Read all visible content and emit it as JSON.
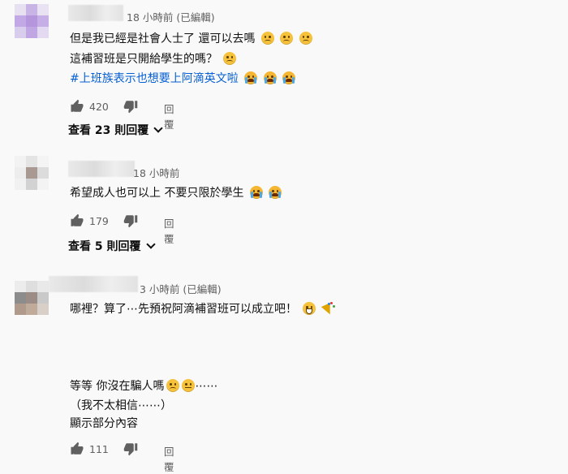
{
  "comments": [
    {
      "time": "18 小時前 (已編輯)",
      "lines": {
        "l1": "但是我已經是社會人士了 還可以去嗎",
        "l2": "這補習班是只開給學生的嗎？",
        "l3": "#上班族表示也想要上阿滴英文啦"
      },
      "emojis": {
        "l1": [
          "sad-face",
          "sad-face",
          "sad-face"
        ],
        "l2": [
          "sad-face"
        ],
        "l3": [
          "crying-face",
          "crying-face",
          "crying-face"
        ]
      },
      "likes": "420",
      "reply_label": "回覆",
      "view_replies": "查看 23 則回覆"
    },
    {
      "time": "18 小時前",
      "lines": {
        "l1": "希望成人也可以上 不要只限於學生"
      },
      "emojis": {
        "l1": [
          "crying-face",
          "crying-face"
        ]
      },
      "likes": "179",
      "reply_label": "回覆",
      "view_replies": "查看 5 則回覆"
    },
    {
      "time": "3 小時前 (已編輯)",
      "lines": {
        "l1": "哪裡？算了⋯先預祝阿滴補習班可以成立吧！",
        "l2": "等等 你沒在騙人嗎",
        "l2_tail": "⋯⋯",
        "l3": "（我不太相信⋯⋯）",
        "l4": "顯示部分內容"
      },
      "emojis": {
        "l1": [
          "grinning-face",
          "party-popper"
        ],
        "l2": [
          "sad-face",
          "neutral-face"
        ]
      },
      "likes": "111",
      "reply_label": "回覆"
    }
  ],
  "icons": {
    "like": "thumbs-up-icon",
    "dislike": "thumbs-down-icon",
    "chevron": "chevron-down-icon"
  },
  "colors": {
    "background": "#f9f9f9",
    "hashtag": "#065fd4",
    "meta": "#606060"
  }
}
